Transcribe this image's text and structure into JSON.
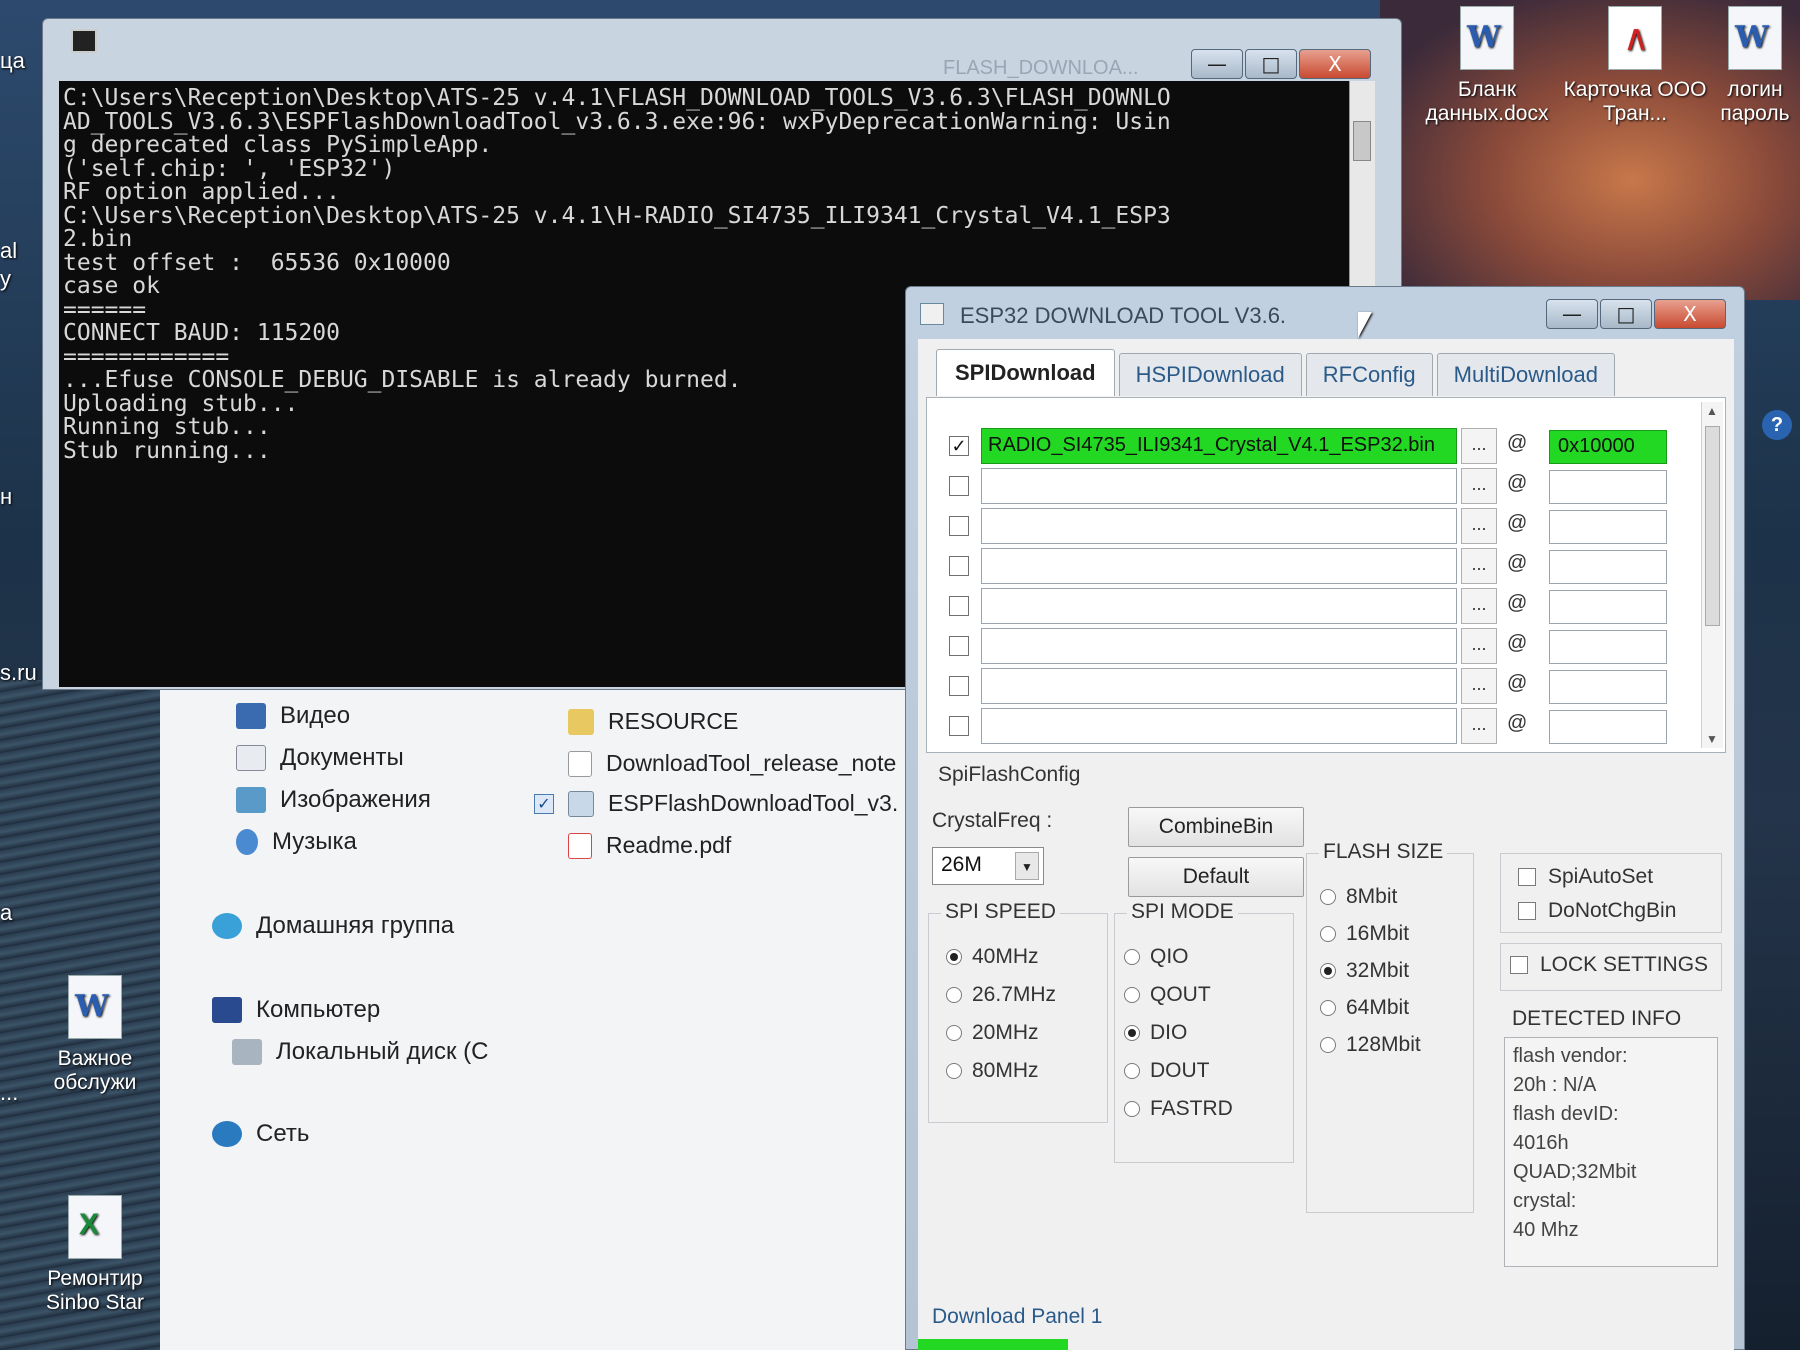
{
  "desktop": {
    "icons": [
      {
        "label": "Бланк данных.docx",
        "type": "word"
      },
      {
        "label": "Карточка ООО Тран...",
        "type": "pdf"
      },
      {
        "label": "логин пароль",
        "type": "word"
      },
      {
        "label": "Важное обслужи",
        "type": "word"
      },
      {
        "label": "Ремонтир Sinbo Star",
        "type": "excel"
      }
    ],
    "left_edge": [
      "ца",
      "al",
      "y",
      "н",
      "s.ru",
      "а",
      "..."
    ]
  },
  "console": {
    "title": "FLASH_DOWNLOA...",
    "lines": [
      "C:\\Users\\Reception\\Desktop\\ATS-25 v.4.1\\FLASH_DOWNLOAD_TOOLS_V3.6.3\\FLASH_DOWNLO",
      "AD_TOOLS_V3.6.3\\ESPFlashDownloadTool_v3.6.3.exe:96: wxPyDeprecationWarning: Usin",
      "g deprecated class PySimpleApp.",
      "('self.chip: ', 'ESP32')",
      "RF option applied...",
      "C:\\Users\\Reception\\Desktop\\ATS-25 v.4.1\\H-RADIO_SI4735_ILI9341_Crystal_V4.1_ESP3",
      "2.bin",
      "test offset :  65536 0x10000",
      "case ok",
      "======",
      "CONNECT BAUD: 115200",
      "============",
      "...Efuse CONSOLE_DEBUG_DISABLE is already burned.",
      "Uploading stub...",
      "Running stub...",
      "Stub running..."
    ]
  },
  "window_controls": {
    "minimize": "—",
    "maximize": "□",
    "close": "X"
  },
  "explorer": {
    "nav": [
      {
        "label": "Видео",
        "icon": "video-icon"
      },
      {
        "label": "Документы",
        "icon": "documents-icon"
      },
      {
        "label": "Изображения",
        "icon": "images-icon"
      },
      {
        "label": "Музыка",
        "icon": "music-icon"
      },
      {
        "label": "Домашняя группа",
        "icon": "homegroup-icon"
      },
      {
        "label": "Компьютер",
        "icon": "computer-icon"
      },
      {
        "label": "Локальный диск (C",
        "icon": "disk-icon"
      },
      {
        "label": "Сеть",
        "icon": "network-icon"
      }
    ],
    "files": [
      {
        "label": "RESOURCE",
        "icon": "folder-icon",
        "checked": false
      },
      {
        "label": "DownloadTool_release_note",
        "icon": "text-file-icon",
        "checked": false
      },
      {
        "label": "ESPFlashDownloadTool_v3.",
        "icon": "app-icon",
        "checked": true
      },
      {
        "label": "Readme.pdf",
        "icon": "pdf-icon",
        "checked": false
      }
    ]
  },
  "esp_tool": {
    "title": "ESP32 DOWNLOAD TOOL V3.6.",
    "tabs": [
      "SPIDownload",
      "HSPIDownload",
      "RFConfig",
      "MultiDownload"
    ],
    "active_tab": "SPIDownload",
    "rows": [
      {
        "checked": true,
        "path": "RADIO_SI4735_ILI9341_Crystal_V4.1_ESP32.bin",
        "addr": "0x10000"
      },
      {
        "checked": false,
        "path": "",
        "addr": ""
      },
      {
        "checked": false,
        "path": "",
        "addr": ""
      },
      {
        "checked": false,
        "path": "",
        "addr": ""
      },
      {
        "checked": false,
        "path": "",
        "addr": ""
      },
      {
        "checked": false,
        "path": "",
        "addr": ""
      },
      {
        "checked": false,
        "path": "",
        "addr": ""
      },
      {
        "checked": false,
        "path": "",
        "addr": ""
      }
    ],
    "browse_label": "...",
    "at_label": "@",
    "spi_flash_config": "SpiFlashConfig",
    "crystal_freq_label": "CrystalFreq :",
    "crystal_freq_value": "26M",
    "combine_bin": "CombineBin",
    "default": "Default",
    "flash_size_title": "FLASH SIZE",
    "flash_sizes": [
      {
        "label": "8Mbit",
        "selected": false
      },
      {
        "label": "16Mbit",
        "selected": false
      },
      {
        "label": "32Mbit",
        "selected": true
      },
      {
        "label": "64Mbit",
        "selected": false
      },
      {
        "label": "128Mbit",
        "selected": false
      }
    ],
    "spi_auto_set": "SpiAutoSet",
    "do_not_chg_bin": "DoNotChgBin",
    "lock_settings": "LOCK SETTINGS",
    "spi_speed_title": "SPI SPEED",
    "spi_speeds": [
      {
        "label": "40MHz",
        "selected": true
      },
      {
        "label": "26.7MHz",
        "selected": false
      },
      {
        "label": "20MHz",
        "selected": false
      },
      {
        "label": "80MHz",
        "selected": false
      }
    ],
    "spi_mode_title": "SPI MODE",
    "spi_modes": [
      {
        "label": "QIO",
        "selected": false
      },
      {
        "label": "QOUT",
        "selected": false
      },
      {
        "label": "DIO",
        "selected": true
      },
      {
        "label": "DOUT",
        "selected": false
      },
      {
        "label": "FASTRD",
        "selected": false
      }
    ],
    "detected_info_title": "DETECTED INFO",
    "detected_info": "flash vendor:\n20h : N/A\nflash devID:\n4016h\nQUAD;32Mbit\ncrystal:\n40 Mhz",
    "download_panel": "Download Panel 1",
    "help": "?"
  },
  "colors": {
    "highlight_green": "#22d822",
    "console_bg": "#0c0c0c"
  }
}
